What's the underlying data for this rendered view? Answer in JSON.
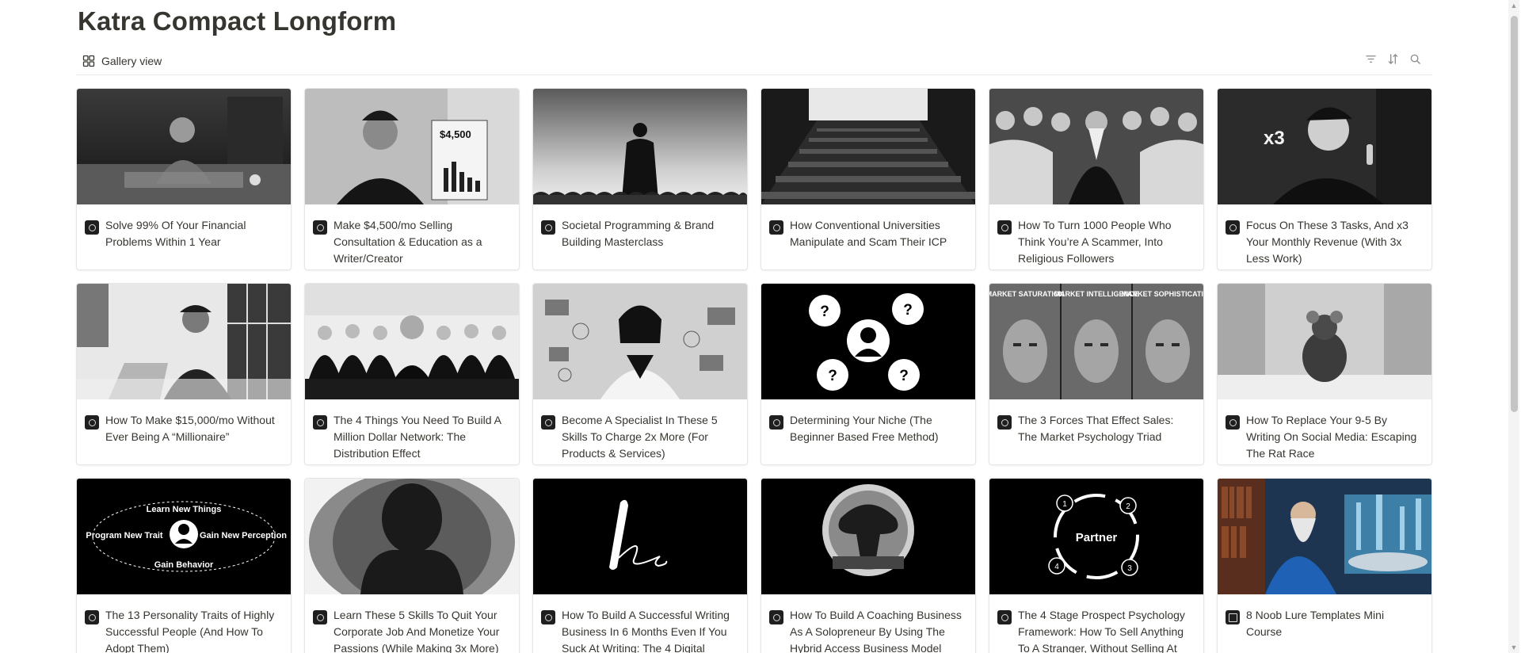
{
  "page": {
    "title": "Katra Compact Longform"
  },
  "view": {
    "label": "Gallery view",
    "icon": "gallery-grid-icon"
  },
  "toolbar": {
    "icons": [
      "filter-icon",
      "sort-icon",
      "search-icon"
    ]
  },
  "cards": [
    {
      "title": "Solve 99% Of Your Financial Problems Within 1 Year",
      "cover": "old-man-at-desk"
    },
    {
      "title": "Make $4,500/mo Selling Consultation & Education as a Writer/Creator",
      "cover": "man-with-chart",
      "cover_text": "$4,500"
    },
    {
      "title": "Societal Programming & Brand Building Masterclass",
      "cover": "figure-over-crowd"
    },
    {
      "title": "How Conventional Universities Manipulate and Scam Their ICP",
      "cover": "lecture-hall"
    },
    {
      "title": "How To Turn 1000 People Who Think You’re A Scammer, Into Religious Followers",
      "cover": "robed-leader"
    },
    {
      "title": "Focus On These 3 Tasks, And x3 Your Monthly Revenue (With 3x Less Work)",
      "cover": "man-in-suit-x3",
      "cover_text": "x3"
    },
    {
      "title": "How To Make $15,000/mo Without Ever Being A “Millionaire”",
      "cover": "man-with-laptop"
    },
    {
      "title": "The 4 Things You Need To Build A Million Dollar Network: The Distribution Effect",
      "cover": "boardroom"
    },
    {
      "title": "Become A Specialist In These 5 Skills To Charge 2x More (For Products & Services)",
      "cover": "woman-tech"
    },
    {
      "title": "Determining Your Niche (The Beginner Based Free Method)",
      "cover": "question-marks",
      "cover_text": "?"
    },
    {
      "title": "The 3 Forces That Effect Sales: The Market Psychology Triad",
      "cover": "three-faces",
      "cover_labels": [
        "MARKET SATURATION",
        "MARKET INTELLIGENCE",
        "MARKET SOPHISTICATION"
      ]
    },
    {
      "title": "How To Replace Your 9-5 By Writing On Social Media: Escaping The Rat Race",
      "cover": "rat-in-office"
    },
    {
      "title": "The 13 Personality Traits of Highly Successful People (And How To Adopt Them)",
      "cover": "traits-diagram",
      "cover_labels": [
        "Learn New Things",
        "Program New Trait",
        "Gain New Perception",
        "Gain Behavior"
      ]
    },
    {
      "title": "Learn These 5 Skills To Quit Your Corporate Job And Monetize Your Passions (While Making 3x More)",
      "cover": "head-silhouette"
    },
    {
      "title": "How To Build A Successful Writing Business In 6 Months Even If You Suck At Writing: The 4 Digital",
      "cover": "pen-signature"
    },
    {
      "title": "How To Build A Coaching Business As A Solopreneur By Using The Hybrid Access Business Model",
      "cover": "tree-circle"
    },
    {
      "title": "The 4 Stage Prospect Psychology Framework: How To Sell Anything To A Stranger, Without Selling At",
      "cover": "partner-cycle",
      "cover_labels": [
        "Partner",
        "1",
        "2",
        "3",
        "4"
      ]
    },
    {
      "title": "8 Noob Lure Templates Mini Course",
      "cover": "wizard-color"
    }
  ]
}
